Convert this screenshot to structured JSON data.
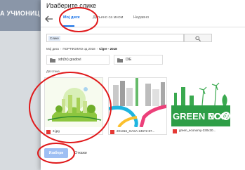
{
  "backdrop": {
    "title": "А УЧИОНИЦ"
  },
  "dialog": {
    "title": "Изаберите слике",
    "tabs": [
      {
        "label": "Мој диск",
        "active": true
      },
      {
        "label": "Дељено са мном",
        "active": false
      },
      {
        "label": "Недавно",
        "active": false
      }
    ],
    "search": {
      "chip": "Слике"
    },
    "breadcrumb": [
      "Мој диск",
      "ПОРТФОЛИО од 2018",
      "Cigre - 2018"
    ],
    "folders": [
      {
        "label": "sdr(hr) gradovi"
      },
      {
        "label": "DIE"
      }
    ],
    "files_label": "Датотеке",
    "files": [
      {
        "name": "3.jpg"
      },
      {
        "name": "201316_GASA-24672-87..."
      },
      {
        "name": "green_economy-330x30..."
      }
    ],
    "file3_logo": {
      "left": "GREEN ECO",
      "right": "NOM"
    },
    "buttons": {
      "select": "Изабери",
      "cancel": "Откажи"
    }
  },
  "colors": {
    "accent": "#1a73e8",
    "annotation": "#e0191b",
    "pdf_badge": "#e53935"
  }
}
